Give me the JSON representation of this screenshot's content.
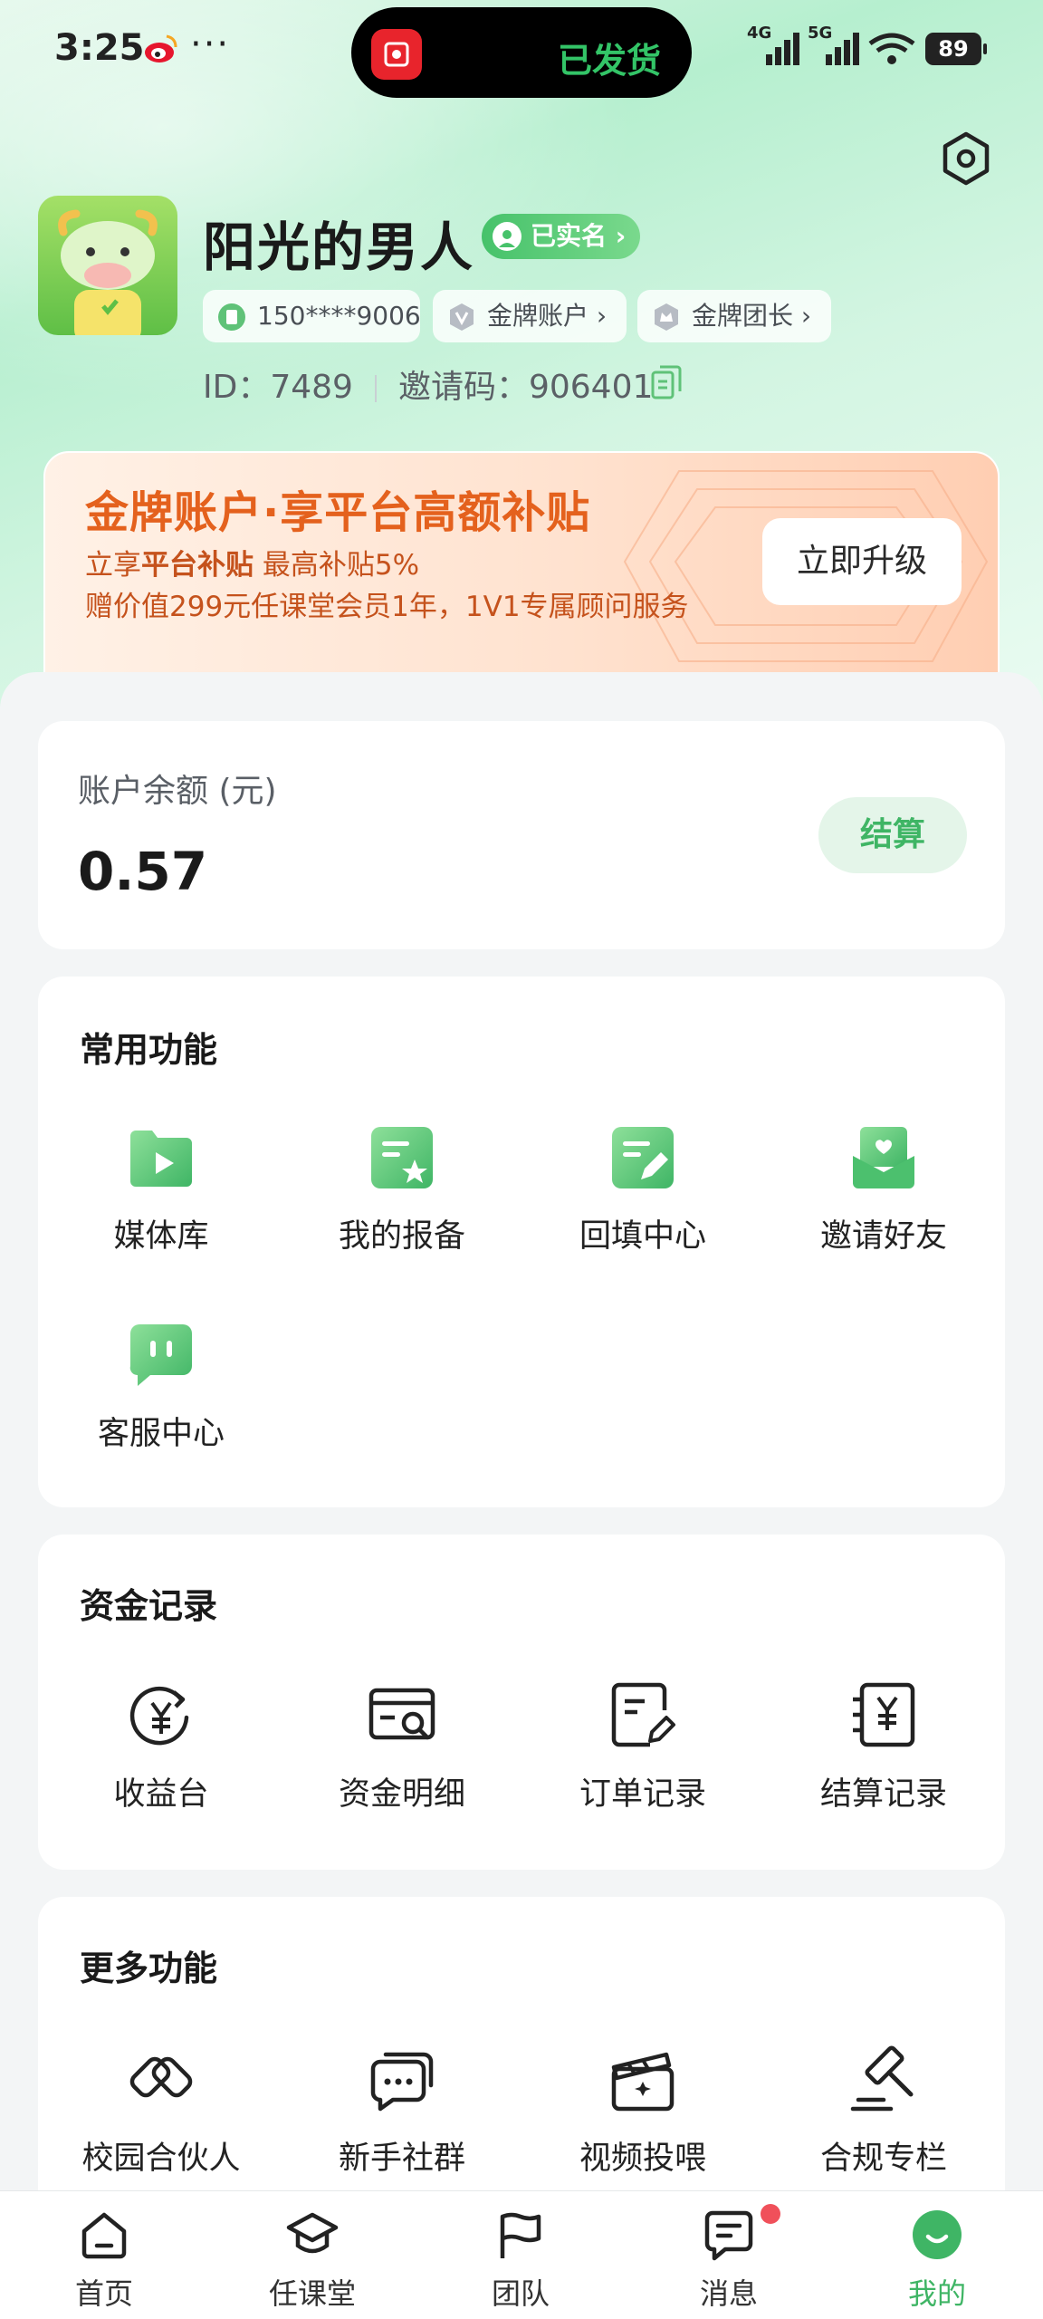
{
  "status_bar": {
    "time": "3:25",
    "dots": "···",
    "island_text": "已发货",
    "net1": "4G",
    "net2": "5G",
    "battery": "89"
  },
  "profile": {
    "nickname": "阳光的男人",
    "verified": "已实名",
    "phone": "150****9006",
    "gold_account": "金牌账户",
    "gold_leader": "金牌团长",
    "id_text": "ID：7489",
    "invite_text": "邀请码：906401"
  },
  "promo": {
    "title": "金牌账户·享平台高额补贴",
    "sub1_prefix": "立享",
    "sub1_bold": "平台补贴",
    "sub1_suffix": " 最高补贴5%",
    "sub2": "赠价值299元任课堂会员1年，1V1专属顾问服务",
    "button": "立即升级"
  },
  "balance": {
    "label": "账户余额 (元)",
    "value": "0.57",
    "button": "结算"
  },
  "common": {
    "title": "常用功能",
    "items": [
      "媒体库",
      "我的报备",
      "回填中心",
      "邀请好友",
      "客服中心"
    ]
  },
  "records": {
    "title": "资金记录",
    "items": [
      "收益台",
      "资金明细",
      "订单记录",
      "结算记录"
    ]
  },
  "more": {
    "title": "更多功能",
    "items": [
      "校园合伙人",
      "新手社群",
      "视频投喂",
      "合规专栏"
    ]
  },
  "nav": {
    "items": [
      "首页",
      "任课堂",
      "团队",
      "消息",
      "我的"
    ]
  },
  "colors": {
    "accent": "#3fb565",
    "promo_text": "#e4611d"
  }
}
